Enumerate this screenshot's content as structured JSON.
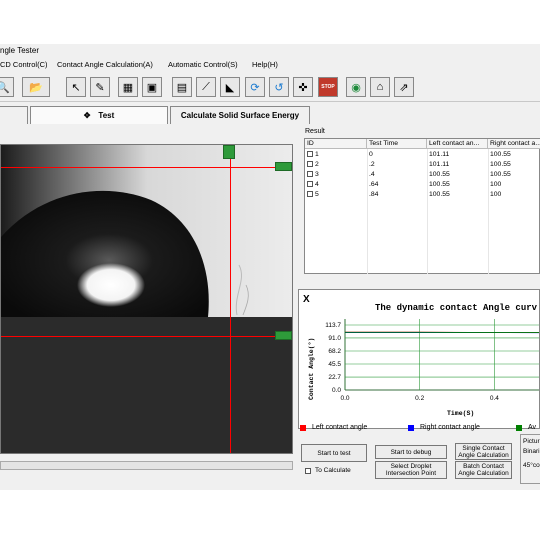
{
  "window": {
    "title": "ngle Tester"
  },
  "menu": [
    "CD Control(C)",
    "Contact Angle Calculation(A)",
    "Automatic Control(S)",
    "Help(H)"
  ],
  "toolbar": {
    "icons": [
      "camera-icon",
      "folder-icon",
      "pointer-icon",
      "edit-icon",
      "calculator-icon",
      "monitor-icon",
      "save-icon",
      "needle-icon",
      "angle-icon",
      "refresh-icon",
      "undo-icon",
      "settings-icon",
      "stop-icon",
      "globe-icon",
      "home-icon",
      "export-icon"
    ]
  },
  "tabs": {
    "test": "Test",
    "surface": "Calculate Solid Surface Energy"
  },
  "result": {
    "label": "Result",
    "columns": [
      "ID",
      "Test Time",
      "Left contact an...",
      "Right contact a..."
    ],
    "rows": [
      {
        "id": "1",
        "time": "0",
        "left": "101.11",
        "right": "100.55"
      },
      {
        "id": "2",
        "time": ".2",
        "left": "101.11",
        "right": "100.55"
      },
      {
        "id": "3",
        "time": ".4",
        "left": "100.55",
        "right": "100.55"
      },
      {
        "id": "4",
        "time": ".64",
        "left": "100.55",
        "right": "100"
      },
      {
        "id": "5",
        "time": ".84",
        "left": "100.55",
        "right": "100"
      }
    ]
  },
  "chart_data": {
    "type": "line",
    "title": "The dynamic contact Angle curv",
    "corner": "X",
    "xlabel": "Time(S)",
    "ylabel": "Contact Angle(°)",
    "yticks": [
      "113.7",
      "91.0",
      "68.2",
      "45.5",
      "22.7",
      "0.0"
    ],
    "xticks": [
      "0.0",
      "0.2",
      "0.4",
      "0.6"
    ],
    "ylim": [
      0,
      113.7
    ],
    "xlim": [
      0,
      0.68
    ],
    "series": [
      {
        "name": "Left contact angle",
        "color": "#ff0000",
        "x": [
          0,
          0.2,
          0.4,
          0.64
        ],
        "y": [
          101.11,
          101.11,
          100.55,
          100.55
        ]
      },
      {
        "name": "Right contact angle",
        "color": "#0000ff",
        "x": [
          0,
          0.2,
          0.4,
          0.64
        ],
        "y": [
          100.55,
          100.55,
          100.55,
          100
        ]
      },
      {
        "name": "Av",
        "color": "#008000",
        "x": [
          0,
          0.2,
          0.4,
          0.64
        ],
        "y": [
          100.83,
          100.83,
          100.55,
          100.27
        ]
      }
    ]
  },
  "buttons": {
    "start_test": "Start to test",
    "to_calculate": "To Calculate",
    "start_debug": "Start to debug",
    "select_droplet": "Select Droplet\nIntersection Point",
    "single_calc": "Single Contact\nAngle Calculation",
    "batch_calc": "Batch Contact\nAngle Calculation",
    "picture": "Pictur",
    "binari": "Binari",
    "deg45": "45°co"
  },
  "colors": {
    "crosshair": "#ff0000",
    "marker": "#2e9a3a"
  }
}
